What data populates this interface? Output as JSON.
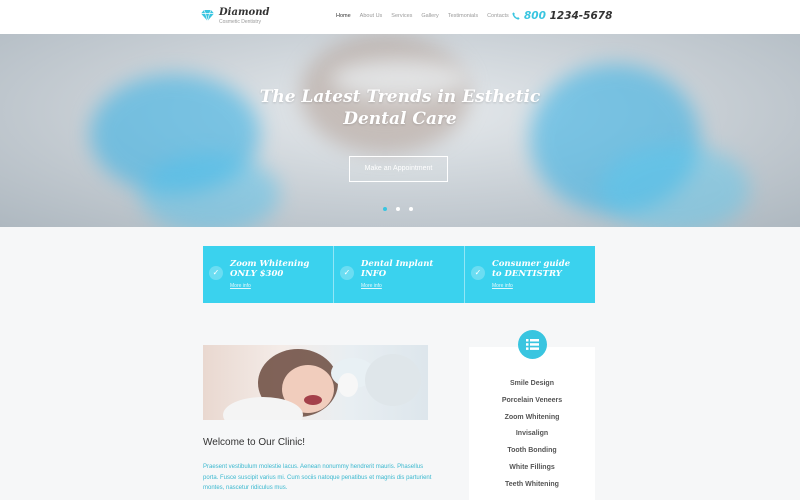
{
  "brand": {
    "title": "Diamond",
    "tagline": "Cosmetic Dentistry"
  },
  "nav": {
    "items": [
      {
        "label": "Home",
        "active": true
      },
      {
        "label": "About Us"
      },
      {
        "label": "Services"
      },
      {
        "label": "Gallery"
      },
      {
        "label": "Testimonials"
      },
      {
        "label": "Contacts"
      }
    ]
  },
  "phone": {
    "prefix": "800",
    "number": "1234-5678"
  },
  "hero": {
    "title_line1": "The Latest Trends in Esthetic",
    "title_line2": "Dental Care",
    "button_label": "Make an Appointment",
    "slides": 3,
    "active_slide": 1
  },
  "features": [
    {
      "line1": "Zoom Whitening",
      "line2": "ONLY $300",
      "link": "More info"
    },
    {
      "line1": "Dental Implant",
      "line2": "INFO",
      "link": "More info"
    },
    {
      "line1": "Consumer guide",
      "line2": "to DENTISTRY",
      "link": "More info"
    }
  ],
  "welcome": {
    "title": "Welcome to Our Clinic!",
    "text": "Praesent vestibulum molestie lacus. Aenean nonummy hendrerit mauris. Phasellus porta. Fusce suscipit varius mi. Cum sociis natoque penatibus et magnis dis parturient montes, nascetur ridiculus mus."
  },
  "services": {
    "icon": "list-icon",
    "items": [
      "Smile Design",
      "Porcelain Veneers",
      "Zoom Whitening",
      "Invisalign",
      "Tooth Bonding",
      "White Fillings",
      "Teeth Whitening"
    ]
  },
  "colors": {
    "accent": "#39c5e0",
    "feature_bg": "#3ad2ee",
    "text_dark": "#333333"
  }
}
